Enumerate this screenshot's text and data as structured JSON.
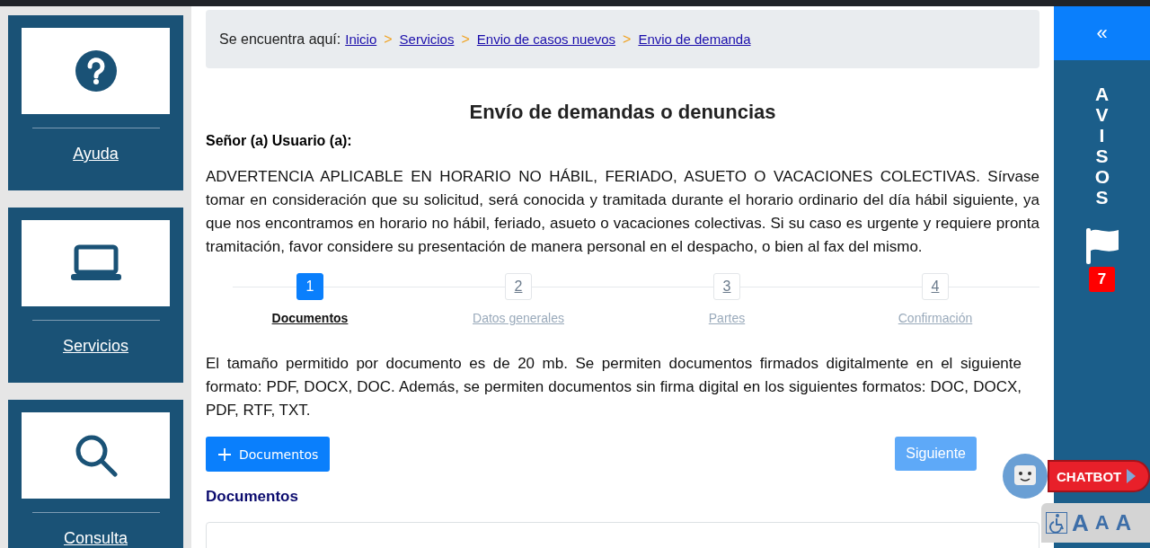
{
  "sidebar": {
    "items": [
      {
        "kind": "help",
        "label": "Ayuda"
      },
      {
        "kind": "laptop",
        "label": "Servicios"
      },
      {
        "kind": "search",
        "label": "Consulta"
      }
    ]
  },
  "breadcrumb": {
    "prefix": "Se encuentra aquí:",
    "separator": ">",
    "links": [
      "Inicio",
      "Servicios",
      "Envio de casos nuevos",
      "Envio de demanda"
    ]
  },
  "title": "Envío de demandas o denuncias",
  "greeting": "Señor (a) Usuario (a):",
  "warning": "ADVERTENCIA APLICABLE EN HORARIO NO HÁBIL, FERIADO, ASUETO O VACACIONES COLECTIVAS. Sírvase tomar en consideración que su solicitud, será conocida y tramitada durante el horario ordinario del día hábil siguiente, ya que nos encontramos en horario no hábil, feriado, asueto o vacaciones colectivas. Si su caso es urgente y requiere pronta tramitación, favor considere su presentación de manera personal en el despacho, o bien al fax del mismo.",
  "steps": [
    {
      "number": "1",
      "label": "Documentos",
      "selected": true
    },
    {
      "number": "2",
      "label": "Datos generales",
      "selected": false
    },
    {
      "number": "3",
      "label": "Partes",
      "selected": false
    },
    {
      "number": "4",
      "label": "Confirmación",
      "selected": false
    }
  ],
  "info": "El tamaño permitido por documento es de 20 mb. Se permiten documentos firmados digitalmente en el siguiente formato: PDF, DOCX, DOC. Además, se permiten documentos sin firma digital en los siguientes formatos: DOC, DOCX, PDF, RTF, TXT.",
  "add_button": "Documentos",
  "next_button": "Siguiente",
  "documents_heading": "Documentos",
  "notices": {
    "collapse": "«",
    "title": "AVISOS",
    "count": "7"
  },
  "chatbot": {
    "label": "CHATBOT"
  },
  "accessibility": {
    "font_buttons": [
      "A",
      "A",
      "A"
    ]
  }
}
